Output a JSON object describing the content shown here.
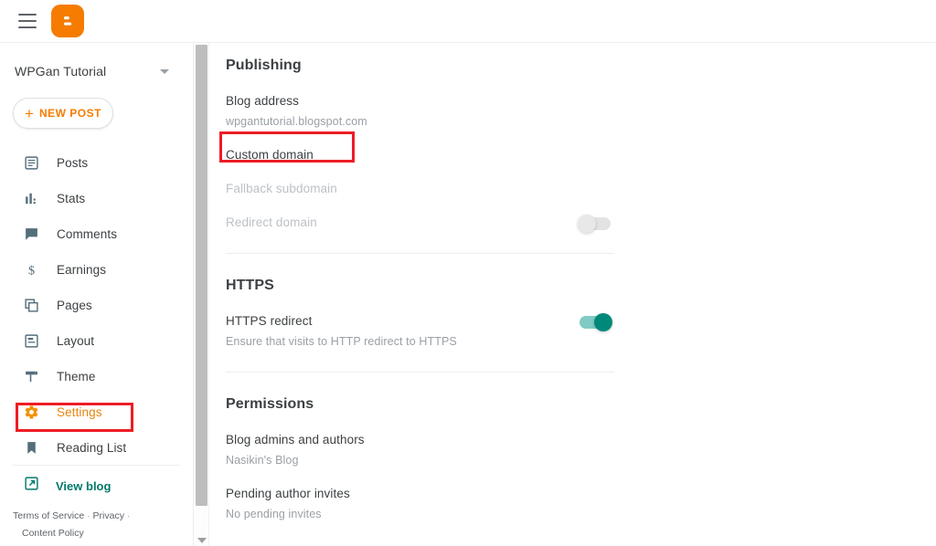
{
  "topbar": {
    "menu_icon": "hamburger-menu-icon",
    "logo_icon": "blogger-logo-icon"
  },
  "sidebar": {
    "blog_selector": {
      "name": "WPGan Tutorial",
      "caret_icon": "chevron-down-icon"
    },
    "new_post": {
      "label": "NEW POST",
      "plus": "+"
    },
    "items": [
      {
        "label": "Posts",
        "icon": "posts-icon",
        "active": false
      },
      {
        "label": "Stats",
        "icon": "stats-icon",
        "active": false
      },
      {
        "label": "Comments",
        "icon": "comments-icon",
        "active": false
      },
      {
        "label": "Earnings",
        "icon": "earnings-icon",
        "active": false
      },
      {
        "label": "Pages",
        "icon": "pages-icon",
        "active": false
      },
      {
        "label": "Layout",
        "icon": "layout-icon",
        "active": false
      },
      {
        "label": "Theme",
        "icon": "theme-icon",
        "active": false
      },
      {
        "label": "Settings",
        "icon": "gear-icon",
        "active": true
      },
      {
        "label": "Reading List",
        "icon": "bookmark-icon",
        "active": false
      }
    ],
    "view_blog": {
      "label": "View blog",
      "icon": "external-link-icon"
    },
    "legal": {
      "terms": "Terms of Service",
      "privacy": "Privacy",
      "content_policy": "Content Policy",
      "separator": "·"
    }
  },
  "main": {
    "publishing": {
      "heading": "Publishing",
      "rows": [
        {
          "title": "Blog address",
          "sub": "wpgantutorial.blogspot.com",
          "disabled": false,
          "toggle": null
        },
        {
          "title": "Custom domain",
          "sub": "",
          "disabled": false,
          "toggle": null
        },
        {
          "title": "Fallback subdomain",
          "sub": "",
          "disabled": true,
          "toggle": null
        },
        {
          "title": "Redirect domain",
          "sub": "",
          "disabled": true,
          "toggle": "off"
        }
      ]
    },
    "https": {
      "heading": "HTTPS",
      "rows": [
        {
          "title": "HTTPS redirect",
          "sub": "Ensure that visits to HTTP redirect to HTTPS",
          "disabled": false,
          "toggle": "on"
        }
      ]
    },
    "permissions": {
      "heading": "Permissions",
      "rows": [
        {
          "title": "Blog admins and authors",
          "sub": "Nasikin's Blog",
          "disabled": false,
          "toggle": null
        },
        {
          "title": "Pending author invites",
          "sub": "No pending invites",
          "disabled": false,
          "toggle": null
        }
      ]
    }
  },
  "annotations": [
    {
      "name": "settings-highlight",
      "target": "Settings",
      "color": "#ee1c25"
    },
    {
      "name": "custom-domain-highlight",
      "target": "Custom domain",
      "color": "#ee1c25"
    }
  ],
  "scrollbar": {
    "arrow_icon": "scroll-down-arrow-icon"
  },
  "colors": {
    "brand_orange": "#f57c00",
    "active_orange": "#e8840c",
    "teal": "#00796b",
    "toggle_on": "#00897b",
    "annotation_red": "#ee1c25",
    "text_primary": "#3c4043",
    "text_secondary": "#9aa0a6"
  }
}
